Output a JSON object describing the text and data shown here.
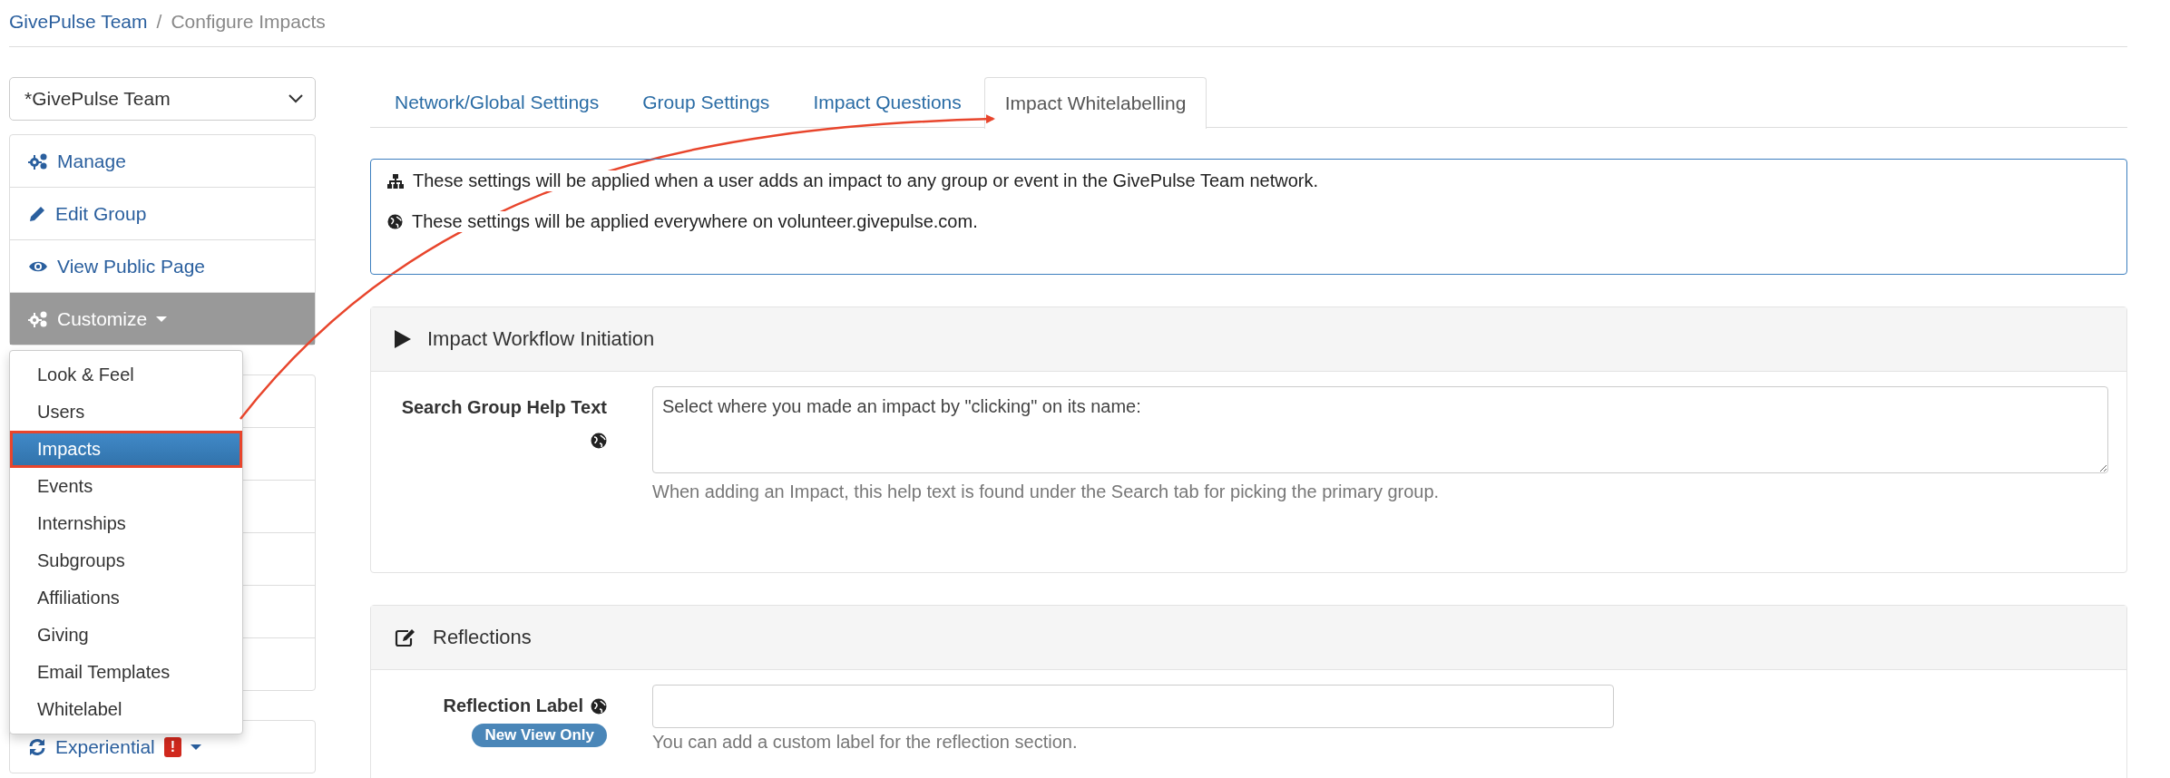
{
  "breadcrumb": [
    {
      "label": "GivePulse Team",
      "kind": "link"
    },
    {
      "label": "/",
      "kind": "separator"
    },
    {
      "label": "Configure Impacts",
      "kind": "current"
    }
  ],
  "sidebar": {
    "group_select": {
      "value": "*GivePulse Team"
    },
    "nav": [
      {
        "label": "Manage",
        "active": false,
        "caret": false
      },
      {
        "label": "Edit Group",
        "active": false,
        "caret": false
      },
      {
        "label": "View Public Page",
        "active": false,
        "caret": false
      },
      {
        "label": "Customize",
        "active": true,
        "caret": true
      }
    ],
    "experiential": {
      "label": "Experiential",
      "badge": "!"
    }
  },
  "dropdown": {
    "items": [
      {
        "label": "Look & Feel",
        "selected": false
      },
      {
        "label": "Users",
        "selected": false
      },
      {
        "label": "Impacts",
        "selected": true
      },
      {
        "label": "Events",
        "selected": false
      },
      {
        "label": "Internships",
        "selected": false
      },
      {
        "label": "Subgroups",
        "selected": false
      },
      {
        "label": "Affiliations",
        "selected": false
      },
      {
        "label": "Giving",
        "selected": false
      },
      {
        "label": "Email Templates",
        "selected": false
      },
      {
        "label": "Whitelabel",
        "selected": false
      }
    ]
  },
  "tabs": [
    {
      "label": "Network/Global Settings",
      "selected": false
    },
    {
      "label": "Group Settings",
      "selected": false
    },
    {
      "label": "Impact Questions",
      "selected": false
    },
    {
      "label": "Impact Whitelabelling",
      "selected": true
    }
  ],
  "info": [
    {
      "text": "These settings will be applied when a user adds an impact to any group or event in the GivePulse Team network."
    },
    {
      "text": "These settings will be applied everywhere on volunteer.givepulse.com."
    }
  ],
  "sections": [
    {
      "title": "Impact Workflow Initiation",
      "fields": [
        {
          "label": "Search Group Help Text",
          "kind": "textarea",
          "global": true,
          "value": "Select where you made an impact by \"clicking\" on its name:",
          "help": "When adding an Impact, this help text is found under the Search tab for picking the primary group."
        }
      ]
    },
    {
      "title": "Reflections",
      "fields": [
        {
          "label": "Reflection Label",
          "kind": "input",
          "global": true,
          "badge": "New View Only",
          "help": "You can add a custom label for the reflection section."
        }
      ]
    }
  ]
}
